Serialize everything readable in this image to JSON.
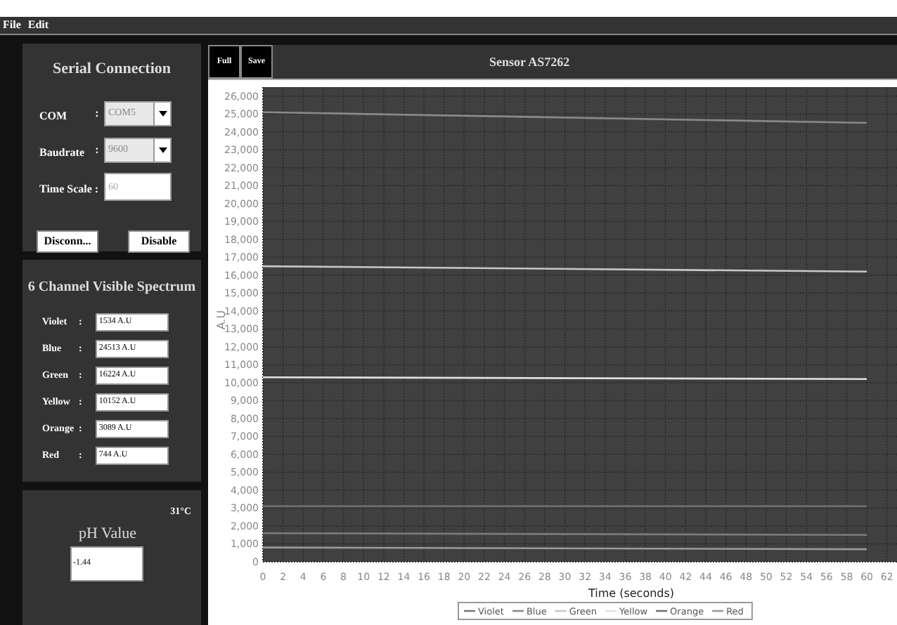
{
  "menu": [
    "File",
    "Edit"
  ],
  "serial_connection": {
    "title": "Serial Connection",
    "fields": [
      {
        "label": "COM",
        "colon": ":",
        "value": "COM5",
        "kind": "combo",
        "disabled": true
      },
      {
        "label": "Baudrate",
        "colon": ":",
        "value": "9600",
        "kind": "combo",
        "disabled": true
      },
      {
        "label": "Time Scale :",
        "placeholder": "60",
        "kind": "text"
      }
    ],
    "buttons": [
      "Disconn...",
      "Disable"
    ]
  },
  "spectrum": {
    "title": "6 Channel Visible Spectrum",
    "channels": [
      {
        "label": "Violet",
        "colon": ":",
        "value": "1534 A.U"
      },
      {
        "label": "Blue",
        "colon": ":",
        "value": "24513 A.U"
      },
      {
        "label": "Green",
        "colon": ":",
        "value": "16224 A.U"
      },
      {
        "label": "Yellow",
        "colon": ":",
        "value": "10152 A.U"
      },
      {
        "label": "Orange",
        "colon": ":",
        "value": "3089 A.U"
      },
      {
        "label": "Red",
        "colon": ":",
        "value": "744 A.U"
      }
    ]
  },
  "ph": {
    "temperature": "31°C",
    "title": "pH Value",
    "value": "-1.44"
  },
  "chart_panel": {
    "buttons": [
      "Full",
      "Save"
    ],
    "title": "Sensor AS7262",
    "chart_data": {
      "type": "line",
      "xlabel": "Time (seconds)",
      "ylabel": "A.U",
      "x": [
        0,
        60
      ],
      "series": [
        {
          "name": "Violet",
          "color": "#7a7a7a",
          "values": [
            1600,
            1500
          ]
        },
        {
          "name": "Blue",
          "color": "#8a8a8a",
          "values": [
            25100,
            24500
          ]
        },
        {
          "name": "Green",
          "color": "#c8c8c8",
          "values": [
            16500,
            16200
          ]
        },
        {
          "name": "Yellow",
          "color": "#e0e0e0",
          "values": [
            10300,
            10200
          ]
        },
        {
          "name": "Orange",
          "color": "#6e6e6e",
          "values": [
            3100,
            3100
          ]
        },
        {
          "name": "Red",
          "color": "#9a9a9a",
          "values": [
            800,
            700
          ]
        }
      ],
      "grid": true,
      "legend": "bottom",
      "xlim": [
        0,
        63
      ],
      "ylim": [
        0,
        26500
      ],
      "xticks": [
        0,
        2,
        4,
        6,
        8,
        10,
        12,
        14,
        16,
        18,
        20,
        22,
        24,
        26,
        28,
        30,
        32,
        34,
        36,
        38,
        40,
        42,
        44,
        46,
        48,
        50,
        52,
        54,
        56,
        58,
        60,
        62
      ],
      "yticks": [
        {
          "value": 0,
          "label": "0"
        },
        {
          "value": 1000,
          "label": "1,000"
        },
        {
          "value": 2000,
          "label": "2,000"
        },
        {
          "value": 3000,
          "label": "3,000"
        },
        {
          "value": 4000,
          "label": "4,000"
        },
        {
          "value": 5000,
          "label": "5,000"
        },
        {
          "value": 6000,
          "label": "6,000"
        },
        {
          "value": 7000,
          "label": "7,000"
        },
        {
          "value": 8000,
          "label": "8,000"
        },
        {
          "value": 9000,
          "label": "9,000"
        },
        {
          "value": 10000,
          "label": "10,000"
        },
        {
          "value": 11000,
          "label": "11,000"
        },
        {
          "value": 12000,
          "label": "12,000"
        },
        {
          "value": 13000,
          "label": "13,000"
        },
        {
          "value": 14000,
          "label": "14,000"
        },
        {
          "value": 15000,
          "label": "15,000"
        },
        {
          "value": 16000,
          "label": "16,000"
        },
        {
          "value": 17000,
          "label": "17,000"
        },
        {
          "value": 18000,
          "label": "18,000"
        },
        {
          "value": 19000,
          "label": "19,000"
        },
        {
          "value": 20000,
          "label": "20,000"
        },
        {
          "value": 21000,
          "label": "21,000"
        },
        {
          "value": 22000,
          "label": "22,000"
        },
        {
          "value": 23000,
          "label": "23,000"
        },
        {
          "value": 24000,
          "label": "24,000"
        },
        {
          "value": 25000,
          "label": "25,000"
        },
        {
          "value": 26000,
          "label": "26,000"
        }
      ]
    }
  }
}
